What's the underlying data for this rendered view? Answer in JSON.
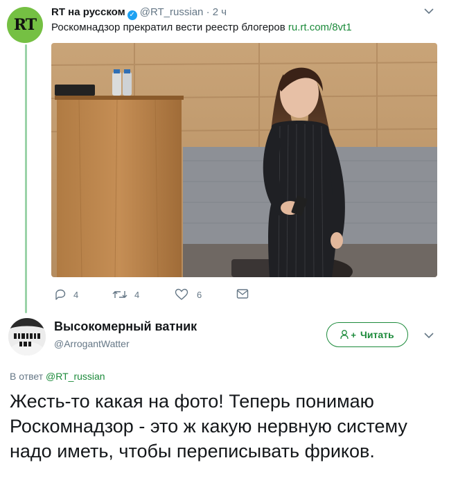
{
  "tweet": {
    "author_name": "RT на русском",
    "handle": "@RT_russian",
    "time": "2 ч",
    "avatar_text": "RT",
    "text": "Роскомнадзор прекратил вести реестр блогеров",
    "link": "ru.rt.com/8vt1",
    "photo_alt": "Photo: woman in pinstriped dress holding a phone beside a wooden podium with water bottles",
    "actions": {
      "replies": "4",
      "retweets": "4",
      "likes": "6"
    }
  },
  "reply": {
    "author_name": "Высокомерный ватник",
    "handle": "@ArrogantWatter",
    "follow_label": "Читать",
    "follow_icon": "+",
    "reply_prefix": "В ответ",
    "reply_to": "@RT_russian",
    "text": "Жесть-то какая на фото! Теперь понимаю Роскомнадзор - это ж какую нервную систему надо иметь, чтобы переписывать фриков."
  },
  "colors": {
    "accent": "#1b8a3a",
    "thread_line": "#9ad3a8",
    "rt_green": "#75c043",
    "verified": "#1da1f2",
    "muted": "#657786"
  }
}
